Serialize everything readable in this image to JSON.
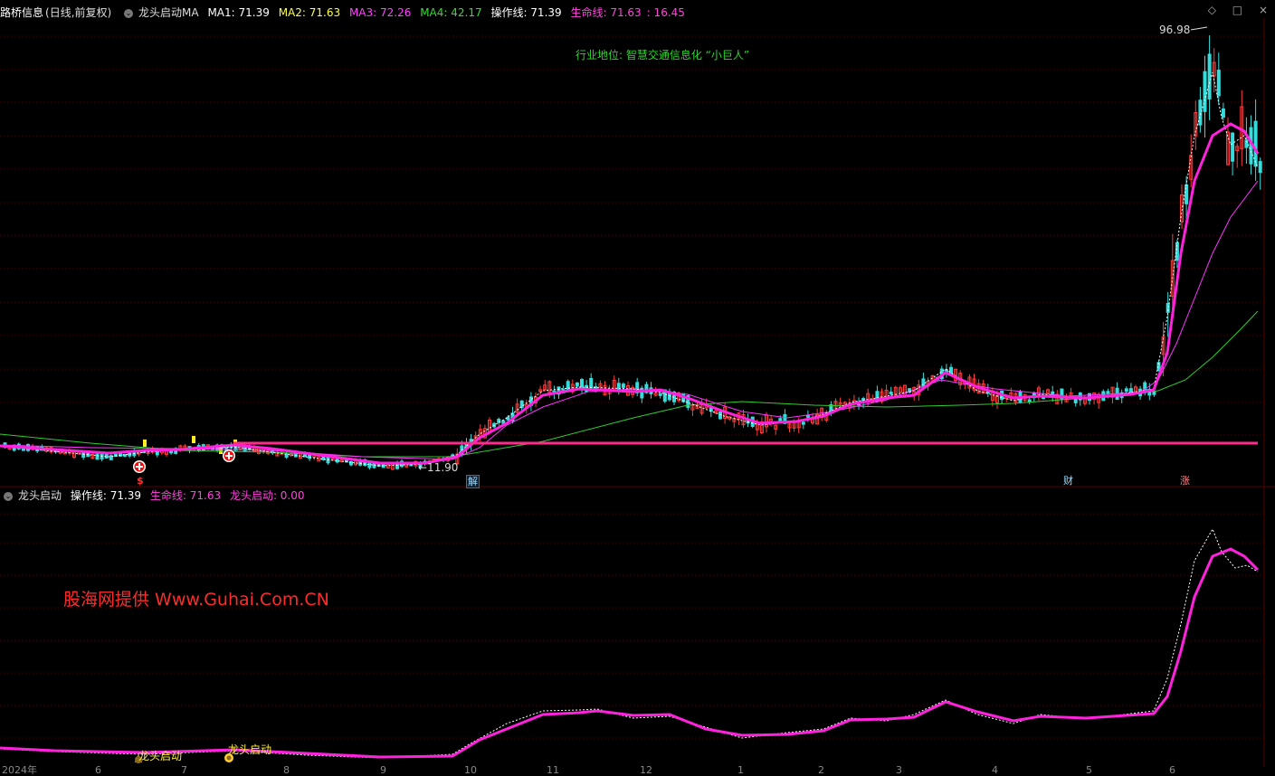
{
  "header": {
    "stock_name": "路桥信息",
    "period": "(日线,前复权)",
    "indicator": "龙头启动MA",
    "ma1": "MA1: 71.39",
    "ma2": "MA2: 71.63",
    "ma3": "MA3: 72.26",
    "ma4": "MA4: 42.17",
    "op_line": "操作线: 71.39",
    "life_line": "生命线: 71.63",
    "extra": ": 16.45"
  },
  "sub_header": {
    "indicator": "龙头启动",
    "op_line": "操作线: 71.39",
    "life_line": "生命线: 71.63",
    "signal": "龙头启动: 0.00"
  },
  "window_controls": {
    "expand": "◇",
    "max": "□",
    "close": "×"
  },
  "annotations": {
    "industry": "行业地位: 智慧交通信息化 “小巨人”",
    "watermark": "股海网提供 Www.Guhai.Com.CN",
    "peak_value": "96.98",
    "low_value": "←11.90",
    "mark_jie": "解",
    "mark_cai": "财",
    "mark_zhang": "涨",
    "mark_dollar": "$",
    "signal1": "龙头启动",
    "signal2": "龙头启动"
  },
  "time_axis": {
    "year": "2024年",
    "months": [
      "6",
      "7",
      "8",
      "9",
      "10",
      "11",
      "12",
      "1",
      "2",
      "3",
      "4",
      "5",
      "6"
    ]
  },
  "colors": {
    "ma1": "#ffffff",
    "ma2": "#ffff00",
    "ma3": "#ff33ff",
    "ma4": "#33cc33",
    "life_line": "#ff33cc",
    "up": "#ff3333",
    "down": "#33dddd",
    "support": "#ff2b8a"
  }
}
